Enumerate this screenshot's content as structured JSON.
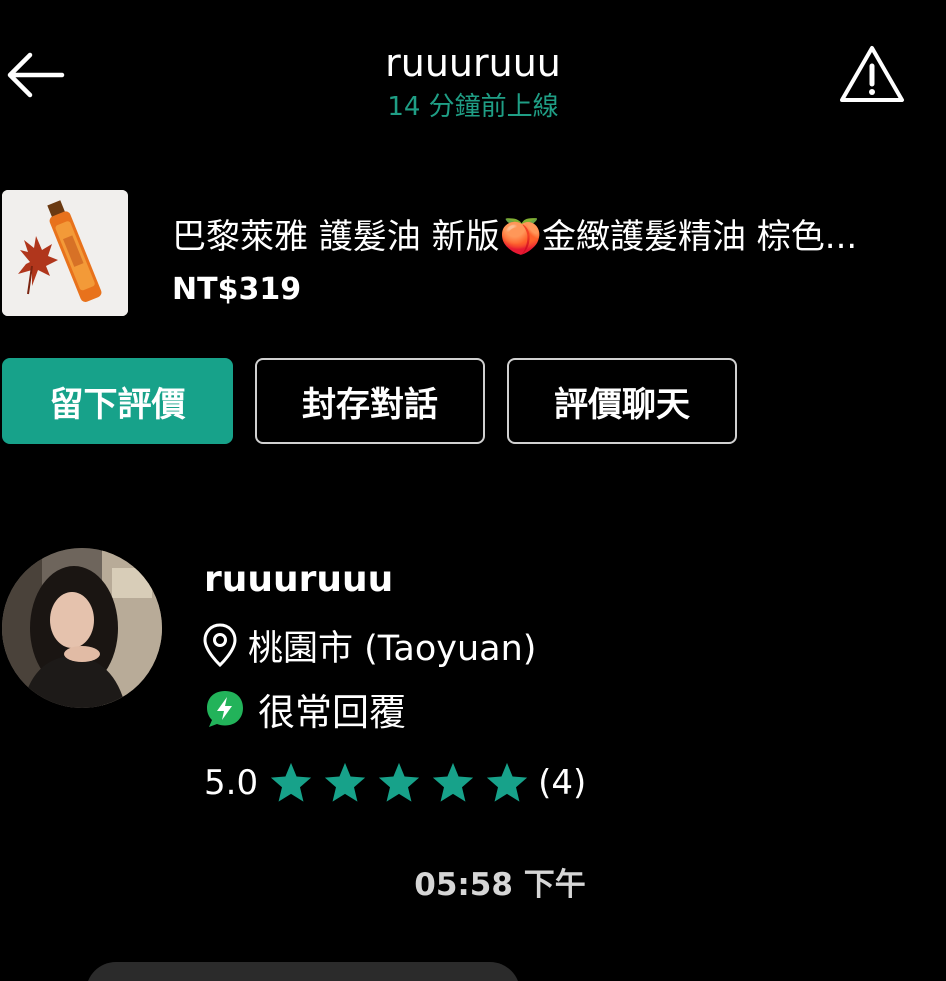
{
  "header": {
    "title": "ruuuruuu",
    "status": "14 分鐘前上線"
  },
  "product": {
    "title": "巴黎萊雅 護髮油 新版🍑金緻護髮精油 棕色...",
    "price": "NT$319"
  },
  "actions": {
    "leave_review": "留下評價",
    "archive_chat": "封存對話",
    "rate_chat": "評價聊天"
  },
  "profile": {
    "name": "ruuuruuu",
    "location": "桃園市 (Taoyuan)",
    "reply_badge": "很常回覆",
    "rating": "5.0",
    "stars": 5,
    "review_count": "(4)"
  },
  "chat": {
    "timestamp": "05:58 下午"
  },
  "colors": {
    "accent": "#17a28a",
    "status_green": "#1f9e85",
    "star": "#17a28a",
    "reply_badge": "#22b35a"
  }
}
